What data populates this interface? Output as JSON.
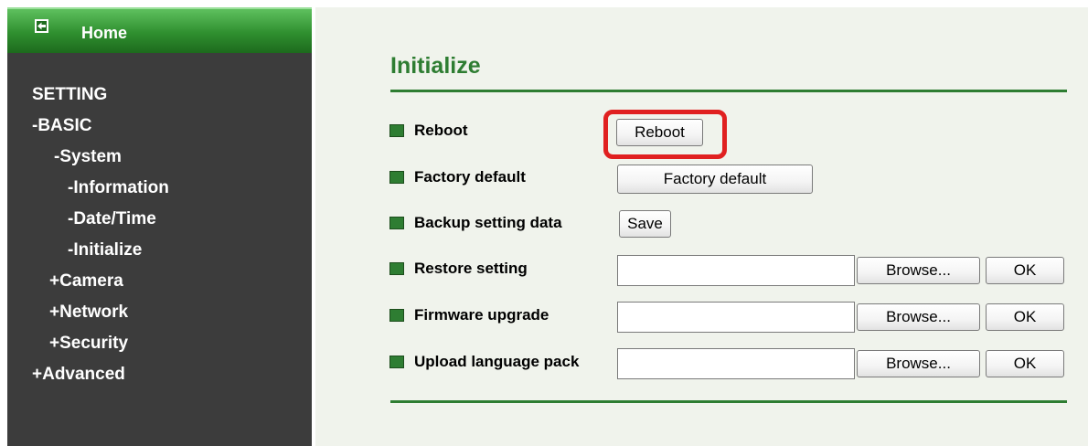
{
  "sidebar": {
    "home_label": "Home",
    "setting": "SETTING",
    "basic": "-BASIC",
    "system": "-System",
    "information": "-Information",
    "datetime": "-Date/Time",
    "initialize_prefix": "-",
    "initialize": "Initialize",
    "camera": "+Camera",
    "network": "+Network",
    "security": "+Security",
    "advanced": "+Advanced"
  },
  "main": {
    "title": "Initialize",
    "rows": [
      {
        "label": "Reboot",
        "button": "Reboot"
      },
      {
        "label": "Factory default",
        "button": "Factory default"
      },
      {
        "label": "Backup setting data",
        "button": "Save"
      },
      {
        "label": "Restore setting",
        "browse": "Browse...",
        "ok": "OK",
        "value": ""
      },
      {
        "label": "Firmware upgrade",
        "browse": "Browse...",
        "ok": "OK",
        "value": ""
      },
      {
        "label": "Upload language pack",
        "browse": "Browse...",
        "ok": "OK",
        "value": ""
      }
    ]
  },
  "colors": {
    "accent": "#2e7d32",
    "sidebar_bg": "#3c3c3c",
    "active_nav": "#3f9b2f",
    "highlight": "#e02020",
    "panel_bg": "#f0f3ec"
  },
  "icons": {
    "home": "back-arrow-icon",
    "row_marker": "square-bullet-icon"
  }
}
